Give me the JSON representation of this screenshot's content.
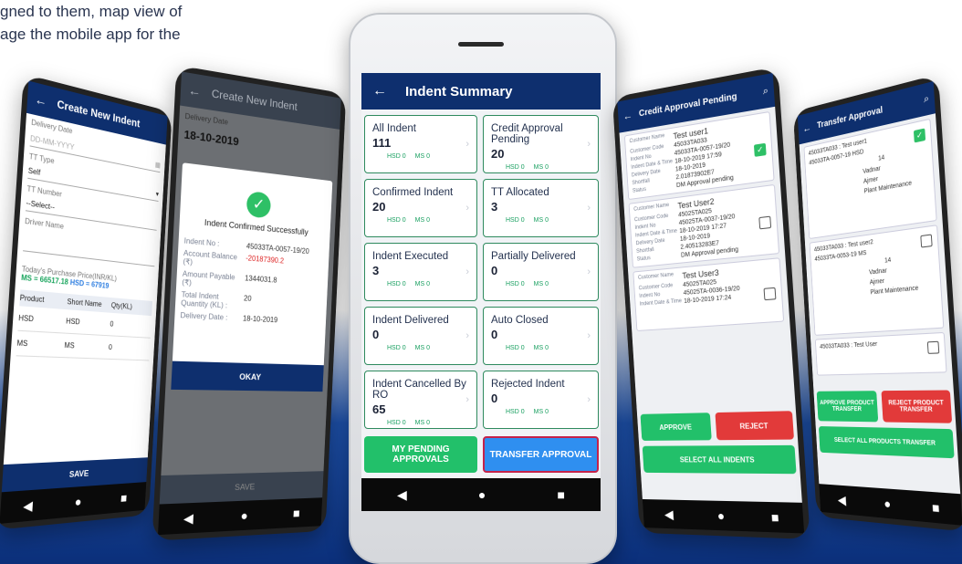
{
  "caption": {
    "line1": "gned to them, map view of",
    "line2": "age the mobile app for the"
  },
  "phone1": {
    "title": "Create New Indent",
    "delivery_date_label": "Delivery Date",
    "delivery_date_placeholder": "DD-MM-YYYY",
    "tt_type_label": "TT Type",
    "tt_type_value": "Self",
    "tt_number_label": "TT Number",
    "tt_number_value": "--Select--",
    "driver_name_label": "Driver Name",
    "price_label": "Today's Purchase Price(INR/KL)",
    "ms_price": "MS = 66517.18",
    "hsd_price": "HSD = 67919",
    "table_headers": [
      "Product",
      "Short Name",
      "Qty(KL)"
    ],
    "table_rows": [
      {
        "product": "HSD",
        "short": "HSD",
        "qty": "0"
      },
      {
        "product": "MS",
        "short": "MS",
        "qty": "0"
      }
    ],
    "save_label": "SAVE"
  },
  "phone2": {
    "title": "Create New Indent",
    "delivery_date_label": "Delivery Date",
    "date_value": "18-10-2019",
    "dialog_title": "Indent Confirmed Successfully",
    "fields": [
      {
        "label": "Indent No :",
        "value": "45033TA-0057-19/20"
      },
      {
        "label": "Account Balance (₹)",
        "value": "-20187390.2"
      },
      {
        "label": "Amount Payable (₹)",
        "value": "1344031.8"
      },
      {
        "label": "Total Indent Quantity (KL) :",
        "value": "20"
      },
      {
        "label": "Delivery Date :",
        "value": "18-10-2019"
      }
    ],
    "okay_label": "OKAY",
    "save_label": "SAVE"
  },
  "phone3": {
    "title": "Indent Summary",
    "tiles": [
      {
        "title": "All Indent",
        "value": "111",
        "hsd": "HSD 0",
        "ms": "MS 0"
      },
      {
        "title": "Credit Approval Pending",
        "value": "20",
        "hsd": "HSD 0",
        "ms": "MS 0"
      },
      {
        "title": "Confirmed Indent",
        "value": "20",
        "hsd": "HSD 0",
        "ms": "MS 0"
      },
      {
        "title": "TT Allocated",
        "value": "3",
        "hsd": "HSD 0",
        "ms": "MS 0"
      },
      {
        "title": "Indent Executed",
        "value": "3",
        "hsd": "HSD 0",
        "ms": "MS 0"
      },
      {
        "title": "Partially Delivered",
        "value": "0",
        "hsd": "HSD 0",
        "ms": "MS 0"
      },
      {
        "title": "Indent Delivered",
        "value": "0",
        "hsd": "HSD 0",
        "ms": "MS 0"
      },
      {
        "title": "Auto Closed",
        "value": "0",
        "hsd": "HSD 0",
        "ms": "MS 0"
      },
      {
        "title": "Indent Cancelled By RO",
        "value": "65",
        "hsd": "HSD 0",
        "ms": "MS 0"
      },
      {
        "title": "Rejected Indent",
        "value": "0",
        "hsd": "HSD 0",
        "ms": "MS 0"
      }
    ],
    "pending_label": "MY PENDING APPROVALS",
    "transfer_label": "TRANSFER APPROVAL"
  },
  "phone4": {
    "title": "Credit Approval Pending",
    "cards": [
      {
        "name": "Test user1",
        "code": "45033TA033",
        "indent": "45033TA-0057-19/20",
        "datetime": "18-10-2019 17:59",
        "delivery": "18-10-2019",
        "shortfall": "2.01873902E7",
        "status": "DM Approval pending",
        "checked": true
      },
      {
        "name": "Test User2",
        "code": "45025TA025",
        "indent": "45025TA-0037-19/20",
        "datetime": "18-10-2019 17:27",
        "delivery": "18-10-2019",
        "shortfall": "2.40513283E7",
        "status": "DM Approval pending",
        "checked": false
      },
      {
        "name": "Test User3",
        "code": "45025TA025",
        "indent": "45025TA-0036-19/20",
        "datetime": "18-10-2019 17:24",
        "delivery": "",
        "shortfall": "",
        "status": "",
        "checked": false
      }
    ],
    "labels": [
      "Customer Name",
      "Customer Code",
      "Indent No",
      "Indent Date & Time",
      "Delivery Date",
      "Shortfall",
      "Status"
    ],
    "approve_label": "APPROVE",
    "reject_label": "REJECT",
    "select_all_label": "SELECT ALL INDENTS"
  },
  "phone5": {
    "title": "Transfer Approval",
    "cards": [
      {
        "name": "45033TA033 : Test user1",
        "indent": "45033TA-0057-19 HSD",
        "qty": "14",
        "from": "Vadnar",
        "to": "Ajmer",
        "reason": "Plant Maintenance",
        "checked": true
      },
      {
        "name": "45033TA033 : Test user2",
        "indent": "45033TA-0053-19 MS",
        "qty": "14",
        "from": "Vadnar",
        "to": "Ajmer",
        "reason": "Plant Maintenance",
        "checked": false
      },
      {
        "name": "45033TA033 : Test User",
        "indent": "",
        "qty": "",
        "from": "",
        "to": "",
        "reason": "",
        "checked": false
      }
    ],
    "approve_label": "APPROVE PRODUCT TRANSFER",
    "reject_label": "REJECT PRODUCT TRANSFER",
    "select_all_label": "SELECT ALL PRODUCTS TRANSFER"
  },
  "nav": {
    "back": "◀",
    "home": "●",
    "recent": "■"
  }
}
